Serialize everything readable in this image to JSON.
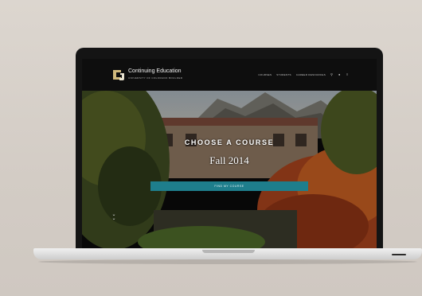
{
  "site": {
    "brand_title": "Continuing Education",
    "brand_subtitle": "UNIVERSITY OF COLORADO BOULDER",
    "logo": "cu-logo"
  },
  "nav": {
    "items": [
      "COURSES",
      "STUDENTS",
      "CAREER RESOURCES"
    ],
    "icons": [
      "search-icon",
      "user-icon",
      "menu-icon"
    ]
  },
  "hero": {
    "headline": "CHOOSE A COURSE",
    "term": "Fall 2014",
    "cta_label": "FIND MY COURSE",
    "scroll_icon": "chevron-down-icon"
  },
  "colors": {
    "cta": "#1e7e8c",
    "topbar": "#0e0e0e",
    "laptop_bezel": "#141414"
  }
}
